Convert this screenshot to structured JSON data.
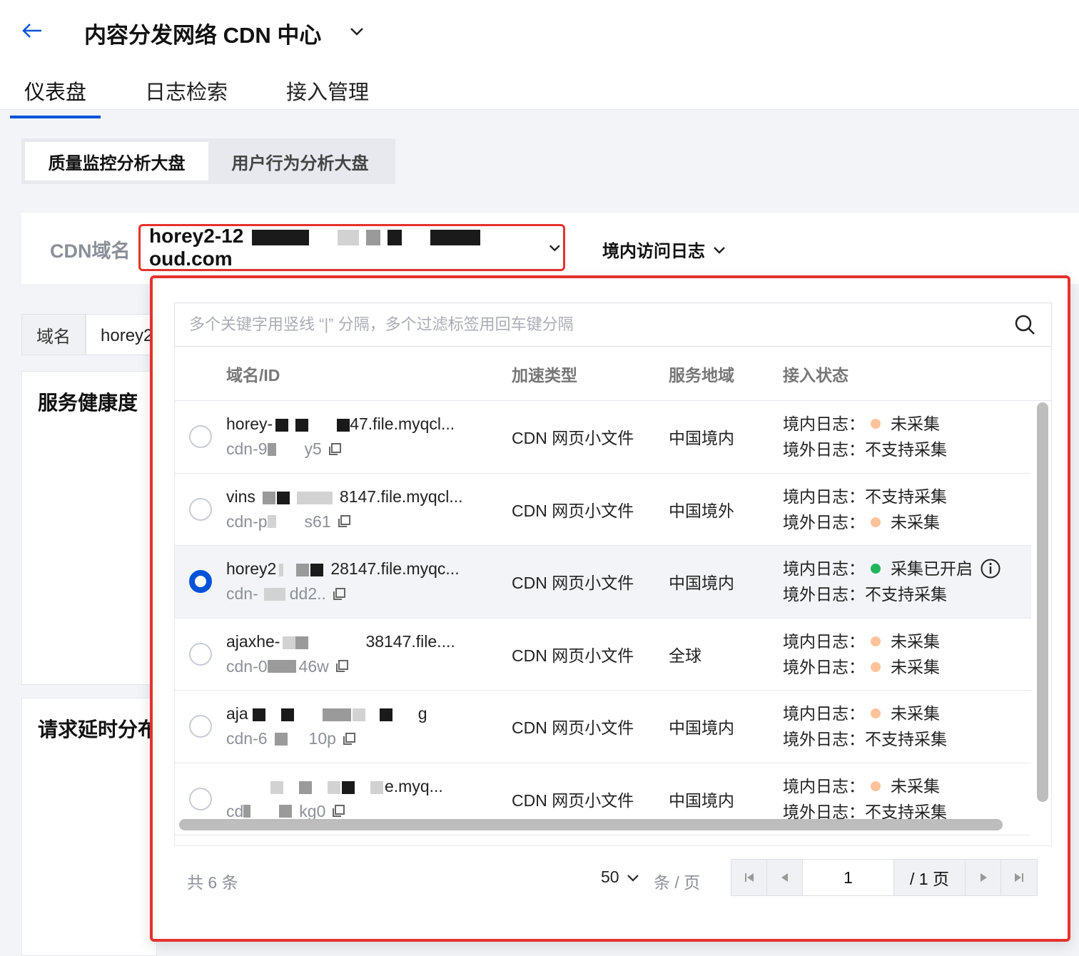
{
  "header": {
    "title": "内容分发网络 CDN 中心",
    "tabs": [
      {
        "label": "仪表盘",
        "active": true
      },
      {
        "label": "日志检索",
        "active": false
      },
      {
        "label": "接入管理",
        "active": false
      }
    ]
  },
  "segments": [
    {
      "label": "质量监控分析大盘",
      "active": true
    },
    {
      "label": "用户行为分析大盘",
      "active": false
    }
  ],
  "filter": {
    "cdn_label": "CDN域名",
    "domain_prefix": "horey2-12",
    "domain_suffix": "oud.com",
    "log_select": "境内访问日志"
  },
  "background": {
    "field_label": "域名",
    "field_value": "horey2",
    "card1_title": "服务健康度",
    "card2_title": "请求延时分布"
  },
  "dropdown": {
    "search_placeholder": "多个关键字用竖线 “|” 分隔，多个过滤标签用回车键分隔",
    "columns": [
      "域名/ID",
      "加速类型",
      "服务地域",
      "接入状态"
    ],
    "rows": [
      {
        "name": "horey-",
        "name_tail": "47.file.myqcl...",
        "id": "cdn-9",
        "id_tail": "y5",
        "type": "CDN 网页小文件",
        "region": "中国境内",
        "status": [
          {
            "label": "境内日志：",
            "dot": "orange",
            "value": "未采集"
          },
          {
            "label": "境外日志：",
            "dot": "",
            "value": "不支持采集"
          }
        ],
        "selected": false
      },
      {
        "name": "vins",
        "name_tail": "8147.file.myqcl...",
        "id": "cdn-p",
        "id_tail": "s61",
        "type": "CDN 网页小文件",
        "region": "中国境外",
        "status": [
          {
            "label": "境内日志：",
            "dot": "",
            "value": "不支持采集"
          },
          {
            "label": "境外日志：",
            "dot": "orange",
            "value": "未采集"
          }
        ],
        "selected": false
      },
      {
        "name": "horey2",
        "name_tail": "28147.file.myqc...",
        "id": "cdn-",
        "id_tail": "dd2..",
        "type": "CDN 网页小文件",
        "region": "中国境内",
        "status": [
          {
            "label": "境内日志：",
            "dot": "green",
            "value": "采集已开启",
            "info": true
          },
          {
            "label": "境外日志：",
            "dot": "",
            "value": "不支持采集"
          }
        ],
        "selected": true
      },
      {
        "name": "ajaxhe-",
        "name_tail": "38147.file....",
        "id": "cdn-0",
        "id_tail": "46w",
        "type": "CDN 网页小文件",
        "region": "全球",
        "status": [
          {
            "label": "境内日志：",
            "dot": "orange",
            "value": "未采集"
          },
          {
            "label": "境外日志：",
            "dot": "orange",
            "value": "未采集"
          }
        ],
        "selected": false
      },
      {
        "name": "aja",
        "name_tail": "g",
        "id": "cdn-6",
        "id_tail": "10p",
        "type": "CDN 网页小文件",
        "region": "中国境内",
        "status": [
          {
            "label": "境内日志：",
            "dot": "orange",
            "value": "未采集"
          },
          {
            "label": "境外日志：",
            "dot": "",
            "value": "不支持采集"
          }
        ],
        "selected": false
      },
      {
        "name": "",
        "name_tail": "e.myq...",
        "id": "cd",
        "id_tail": "kg0",
        "type": "CDN 网页小文件",
        "region": "中国境内",
        "status": [
          {
            "label": "境内日志：",
            "dot": "orange",
            "value": "未采集"
          },
          {
            "label": "境外日志：",
            "dot": "",
            "value": "不支持采集"
          }
        ],
        "selected": false
      }
    ],
    "footer": {
      "total": "共 6 条",
      "page_size": "50",
      "page_size_unit": "条 / 页",
      "current_page": "1",
      "total_pages": "/ 1 页"
    }
  },
  "colors": {
    "accent": "#0052d9",
    "highlight_border": "#e5322d",
    "status_orange": "#ffc39b",
    "status_green": "#21b45c"
  },
  "icons": [
    "arrow-left-icon",
    "chevron-down-icon",
    "search-icon",
    "copy-icon",
    "info-icon",
    "first-page-icon",
    "prev-page-icon",
    "next-page-icon",
    "last-page-icon"
  ]
}
